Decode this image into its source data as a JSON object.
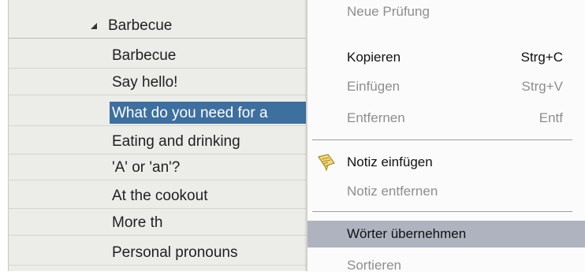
{
  "tree": {
    "parent": {
      "label": "Barbecue",
      "expanded": true
    },
    "items": [
      {
        "label": "Barbecue"
      },
      {
        "label": "Say hello!"
      },
      {
        "label": "What do you need for a",
        "selected": true
      },
      {
        "label": "Eating and drinking"
      },
      {
        "label": "'A' or 'an'?"
      },
      {
        "label": "At the cookout"
      },
      {
        "label": "More th"
      },
      {
        "label": "Personal pronouns"
      }
    ]
  },
  "menu": {
    "items": [
      {
        "label": "Neue Prüfung",
        "shortcut": "",
        "enabled": false
      },
      {
        "label": "Kopieren",
        "shortcut": "Strg+C",
        "enabled": true
      },
      {
        "label": "Einfügen",
        "shortcut": "Strg+V",
        "enabled": false
      },
      {
        "label": "Entfernen",
        "shortcut": "Entf",
        "enabled": false
      },
      {
        "label": "Notiz einfügen",
        "shortcut": "",
        "enabled": true,
        "icon": "note-icon"
      },
      {
        "label": "Notiz entfernen",
        "shortcut": "",
        "enabled": false
      },
      {
        "label": "Wörter übernehmen",
        "shortcut": "",
        "enabled": true,
        "hovered": true
      },
      {
        "label": "Sortieren",
        "shortcut": "",
        "enabled": false
      }
    ]
  },
  "colors": {
    "tree_background": "#ecece8",
    "selection": "#3d6f9f",
    "menu_hover": "#aeb3bf",
    "disabled_text": "#8e8e8e"
  }
}
